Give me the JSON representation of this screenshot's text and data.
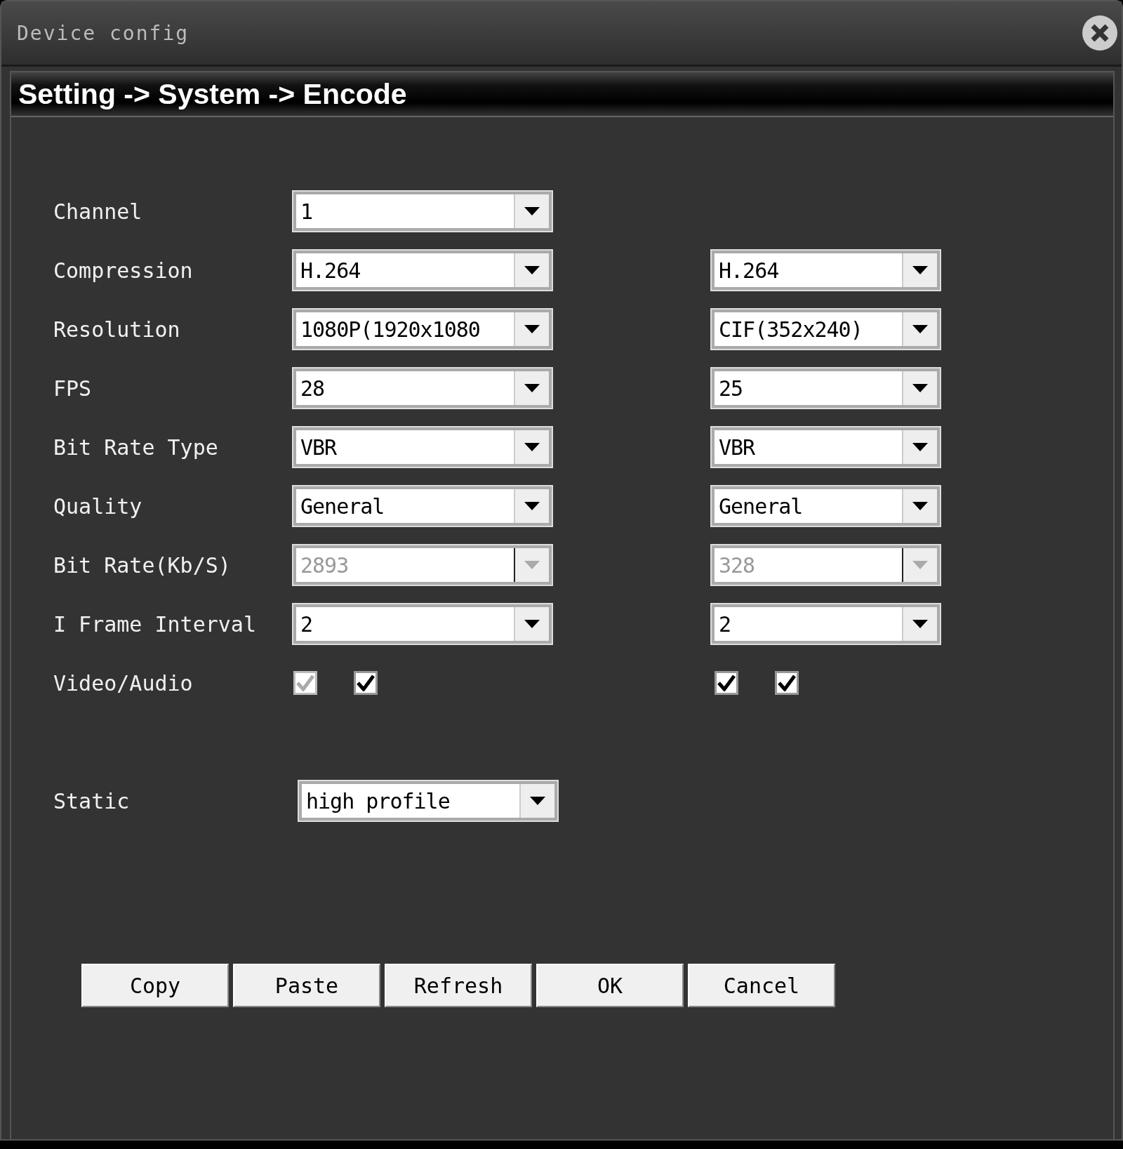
{
  "window": {
    "title": "Device config"
  },
  "breadcrumb": "Setting -> System -> Encode",
  "rows": [
    {
      "kind": "select",
      "label": "Channel",
      "main": {
        "value": "1",
        "disabled": false
      }
    },
    {
      "kind": "select",
      "label": "Compression",
      "main": {
        "value": "H.264",
        "disabled": false
      },
      "sub": {
        "value": "H.264",
        "disabled": false
      }
    },
    {
      "kind": "select",
      "label": "Resolution",
      "main": {
        "value": "1080P(1920x1080",
        "disabled": false
      },
      "sub": {
        "value": "CIF(352x240)",
        "disabled": false
      }
    },
    {
      "kind": "select",
      "label": "FPS",
      "main": {
        "value": "28",
        "disabled": false
      },
      "sub": {
        "value": "25",
        "disabled": false
      }
    },
    {
      "kind": "select",
      "label": "Bit Rate Type",
      "main": {
        "value": "VBR",
        "disabled": false
      },
      "sub": {
        "value": "VBR",
        "disabled": false
      }
    },
    {
      "kind": "select",
      "label": "Quality",
      "main": {
        "value": "General",
        "disabled": false
      },
      "sub": {
        "value": "General",
        "disabled": false
      }
    },
    {
      "kind": "select",
      "label": "Bit Rate(Kb/S)",
      "main": {
        "value": "2893",
        "disabled": true
      },
      "sub": {
        "value": "328",
        "disabled": true
      }
    },
    {
      "kind": "select",
      "label": "I Frame Interval",
      "main": {
        "value": "2",
        "disabled": false
      },
      "sub": {
        "value": "2",
        "disabled": false
      }
    },
    {
      "kind": "checks",
      "label": "Video/Audio",
      "main": [
        {
          "checked": true,
          "disabled": true
        },
        {
          "checked": true,
          "disabled": false
        }
      ],
      "sub": [
        {
          "checked": true,
          "disabled": false
        },
        {
          "checked": true,
          "disabled": false
        }
      ]
    }
  ],
  "static": {
    "label": "Static",
    "value": "high profile"
  },
  "buttons": [
    "Copy",
    "Paste",
    "Refresh",
    "OK",
    "Cancel"
  ]
}
